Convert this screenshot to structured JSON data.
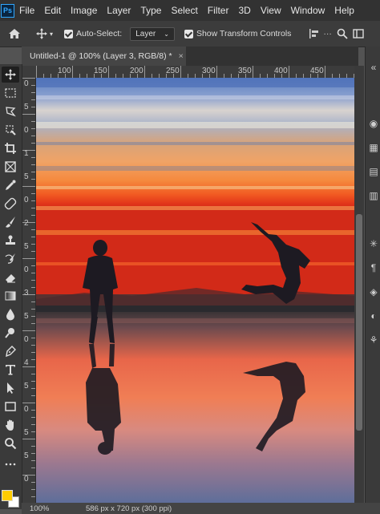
{
  "app": {
    "logo_text": "Ps"
  },
  "menu": [
    "File",
    "Edit",
    "Image",
    "Layer",
    "Type",
    "Select",
    "Filter",
    "3D",
    "View",
    "Window",
    "Help"
  ],
  "options": {
    "auto_select_label": "Auto-Select:",
    "auto_select_value": "Layer",
    "show_transform_label": "Show Transform Controls"
  },
  "document": {
    "tab_title": "Untitled-1 @ 100% (Layer 3, RGB/8) *",
    "close_glyph": "×"
  },
  "ruler": {
    "top_labels": [
      "100",
      "150",
      "200",
      "250",
      "300",
      "350",
      "400",
      "450"
    ],
    "left_labels": [
      "0",
      "5",
      "0",
      "1",
      "5",
      "0",
      "2",
      "5",
      "0",
      "3",
      "5",
      "0",
      "4",
      "5",
      "0",
      "5",
      "5",
      "0"
    ]
  },
  "status": {
    "zoom": "100%",
    "doc_info": "586 px x 720 px (300 ppi)"
  },
  "colors": {
    "foreground": "#ffcc00",
    "background": "#ffffff",
    "accent": "#31a8ff"
  },
  "tools": [
    "move-icon",
    "marquee-icon",
    "lasso-icon",
    "quick-select-icon",
    "crop-icon",
    "frame-icon",
    "eyedropper-icon",
    "healing-brush-icon",
    "brush-icon",
    "clone-stamp-icon",
    "history-brush-icon",
    "eraser-icon",
    "gradient-icon",
    "blur-icon",
    "dodge-icon",
    "pen-icon",
    "type-icon",
    "path-select-icon",
    "rectangle-icon",
    "hand-icon",
    "zoom-icon",
    "more-tools-icon"
  ]
}
